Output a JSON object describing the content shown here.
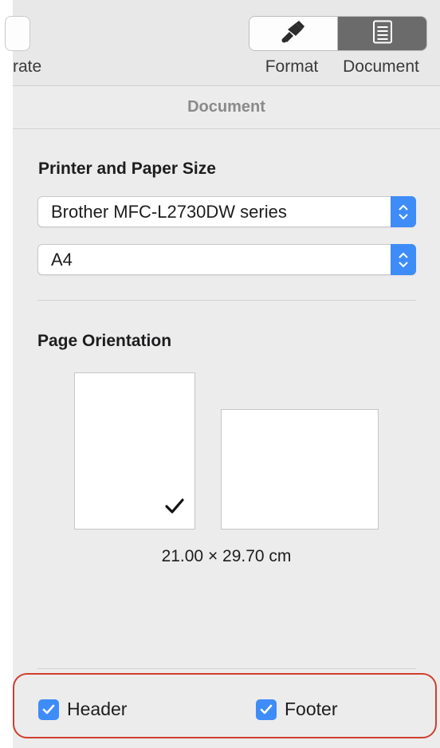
{
  "toolbar": {
    "left_label": "rate",
    "format_label": "Format",
    "document_label": "Document",
    "format_icon": "paintbrush-icon",
    "document_icon": "document-icon"
  },
  "panel": {
    "tab_title": "Document",
    "printer_section_title": "Printer and Paper Size",
    "printer_value": "Brother MFC-L2730DW series",
    "paper_value": "A4",
    "orientation_title": "Page Orientation",
    "selected_orientation": "portrait",
    "paper_size_text": "21.00 × 29.70 cm",
    "header_label": "Header",
    "header_checked": true,
    "footer_label": "Footer",
    "footer_checked": true
  },
  "colors": {
    "accent": "#3e8cf7",
    "highlight": "#cf3f2f",
    "panel_bg": "#ececec",
    "toolbar_bg": "#e9e8e9"
  }
}
